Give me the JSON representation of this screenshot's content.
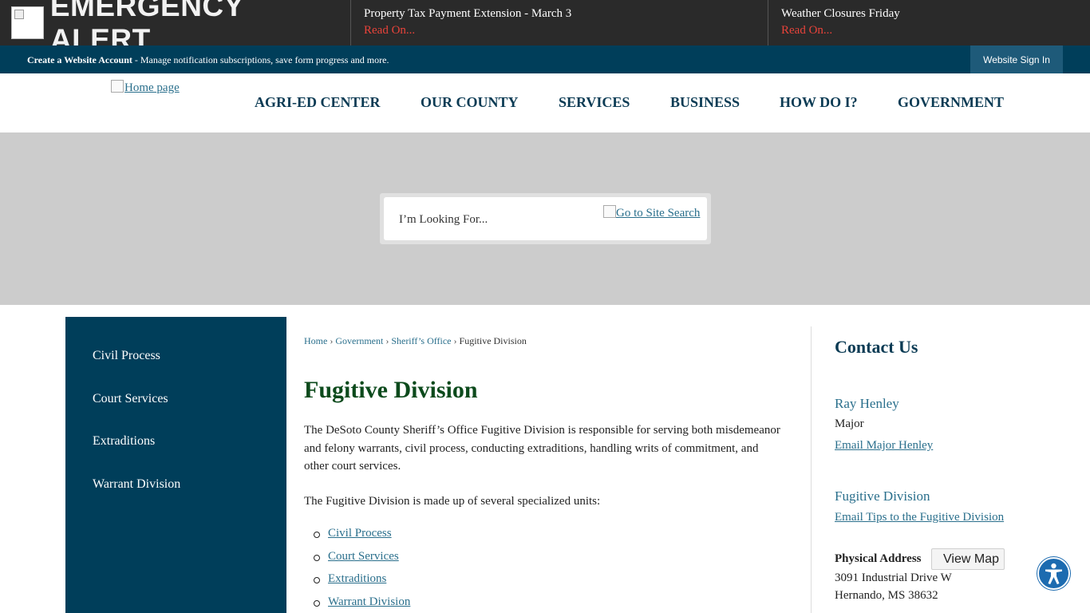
{
  "alert": {
    "title": "EMERGENCY ALERT",
    "items": [
      {
        "title": "Property Tax Payment Extension - March 3",
        "link": "Read On..."
      },
      {
        "title": "Weather Closures Friday",
        "link": "Read On..."
      }
    ]
  },
  "account_bar": {
    "create_label": "Create a Website Account",
    "create_desc": " - Manage notification subscriptions, save form progress and more.",
    "signin_label": "Website Sign In"
  },
  "header": {
    "logo_alt": "Home page",
    "nav": [
      "AGRI-ED CENTER",
      "OUR COUNTY",
      "SERVICES",
      "BUSINESS",
      "HOW DO I?",
      "GOVERNMENT"
    ]
  },
  "search": {
    "placeholder": "I’m Looking For...",
    "go_label": "Go to Site Search"
  },
  "sidebar": {
    "items": [
      "Civil Process",
      "Court Services",
      "Extraditions",
      "Warrant Division"
    ]
  },
  "breadcrumb": {
    "items": [
      "Home",
      "Government",
      "Sheriff’s Office"
    ],
    "current": "Fugitive Division",
    "separator": "›"
  },
  "main": {
    "title": "Fugitive Division",
    "paragraph1_line1": "The DeSoto County Sheriff’s Office Fugitive Division is responsible for serving both misdemeanor",
    "paragraph1_line2": "and felony warrants, civil process, conducting extraditions, handling writs of commitment, and",
    "paragraph1_line3": "other court services.",
    "paragraph2": "The Fugitive Division is made up of several specialized units:",
    "units": [
      "Civil Process",
      "Court Services",
      "Extraditions",
      "Warrant Division"
    ]
  },
  "contact": {
    "title": "Contact Us",
    "person_name": "Ray Henley",
    "person_role": "Major",
    "person_email": "Email Major Henley",
    "division_name": "Fugitive Division",
    "division_email": "Email Tips to the Fugitive Division",
    "address_label": "Physical Address",
    "map_button": "View Map",
    "address_line1": "3091 Industrial Drive W",
    "address_line2": "Hernando, MS 38632"
  },
  "colors": {
    "alert_bg": "#2a2a2a",
    "alert_link": "#e8433a",
    "brand_navy": "#003e5a",
    "nav_text": "#0b3b54",
    "title_green": "#0c4a1c",
    "link": "#2a6f8c",
    "accessibility": "#1c6bb0"
  },
  "icons": {
    "alert": "broken-image-icon",
    "accessibility": "accessibility-icon"
  }
}
